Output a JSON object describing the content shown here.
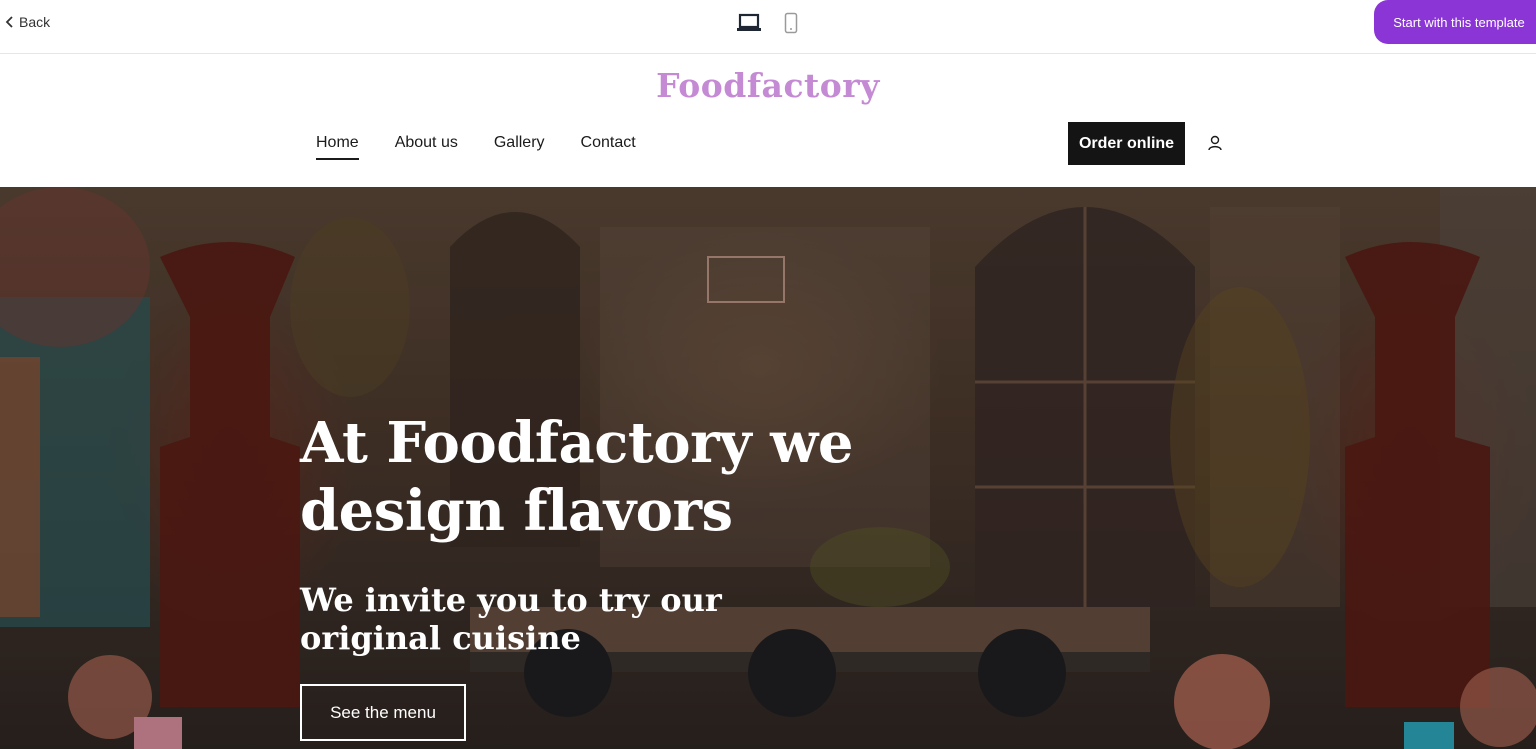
{
  "editor_bar": {
    "back_label": "Back",
    "start_label": "Start with this template",
    "accent": "#8b35d6"
  },
  "site": {
    "logo": "Foodfactory",
    "logo_color": "#c58ad4",
    "nav": [
      {
        "label": "Home",
        "active": true
      },
      {
        "label": "About us",
        "active": false
      },
      {
        "label": "Gallery",
        "active": false
      },
      {
        "label": "Contact",
        "active": false
      }
    ],
    "order_label": "Order online"
  },
  "hero": {
    "title": "At Foodfactory we design flavors",
    "subtitle": "We invite you to try our original cuisine",
    "cta_label": "See the menu"
  },
  "icons": {
    "back": "chevron-left-icon",
    "desktop": "laptop-icon",
    "mobile": "smartphone-icon",
    "user": "user-icon"
  }
}
